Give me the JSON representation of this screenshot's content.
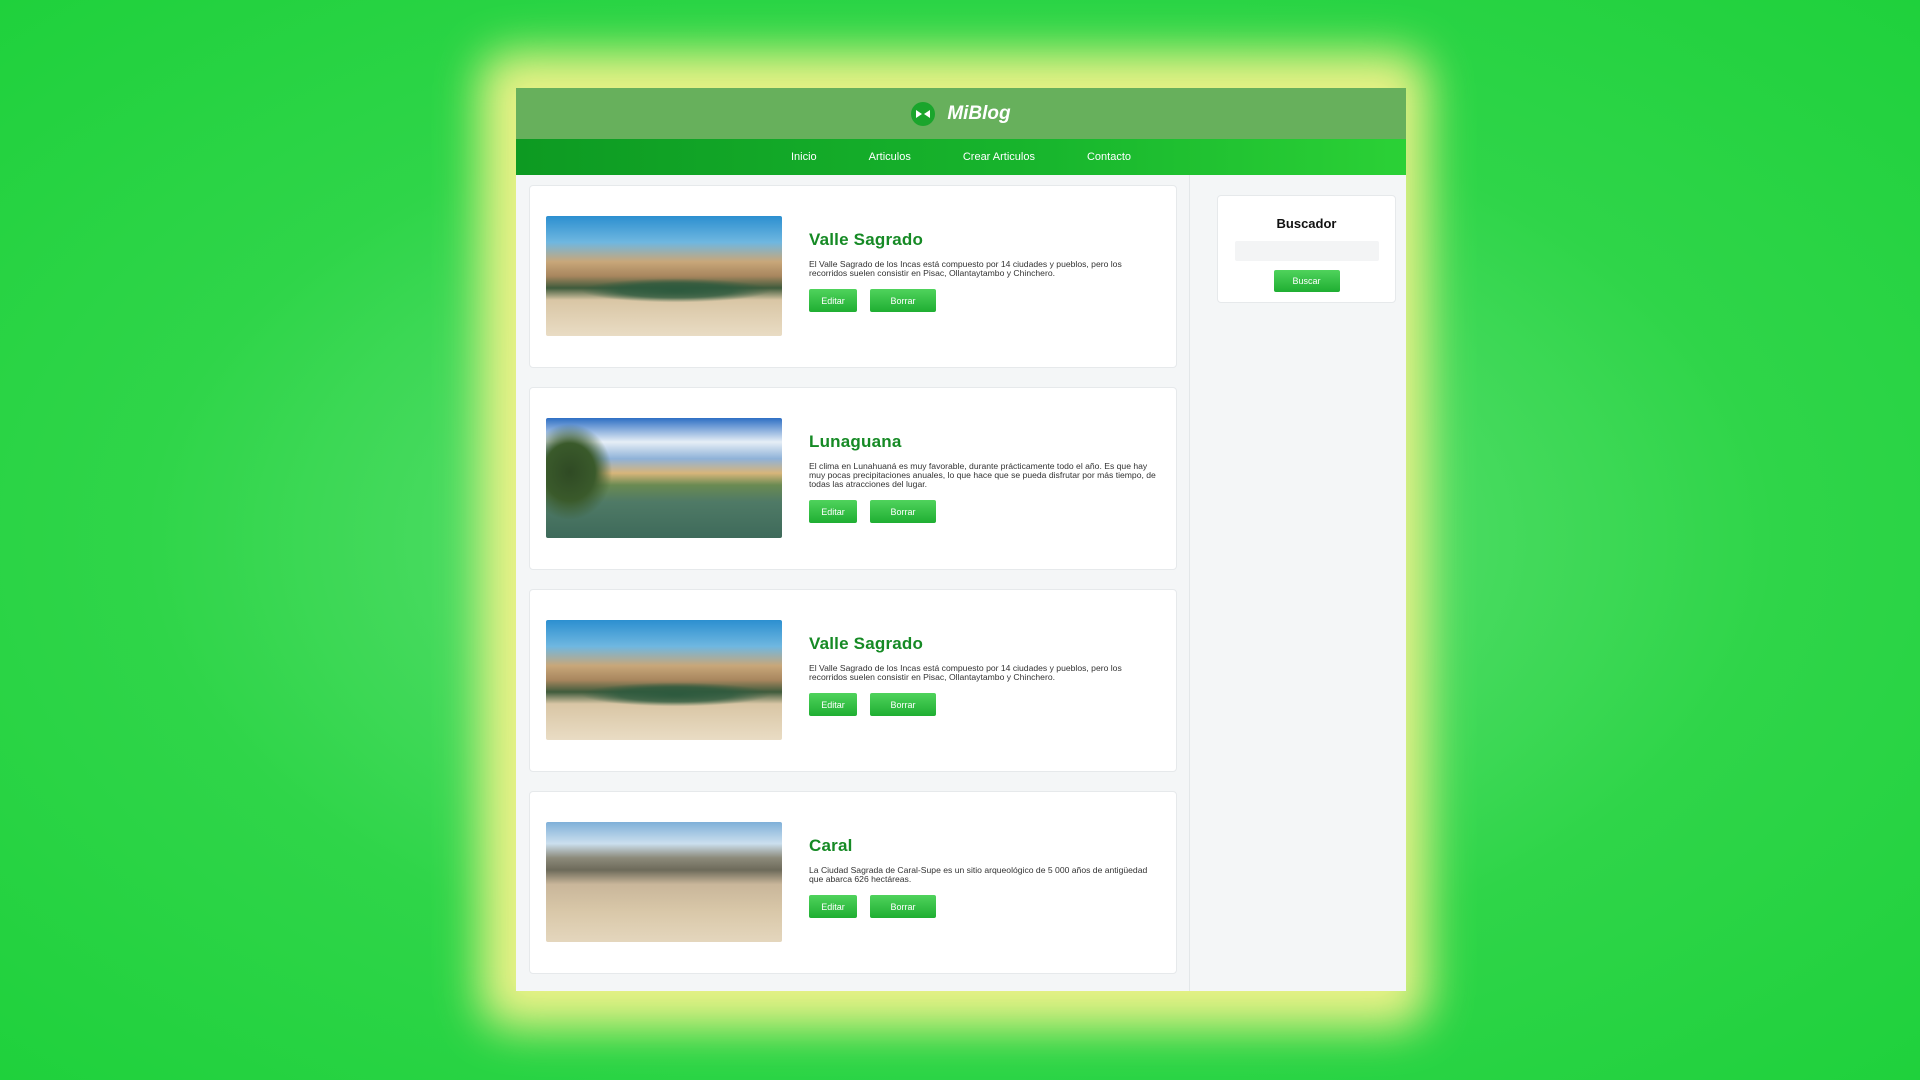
{
  "header": {
    "brand": "MiBlog",
    "logo_icon": "eye-logo-icon"
  },
  "nav": {
    "items": [
      "Inicio",
      "Articulos",
      "Crear Articulos",
      "Contacto"
    ]
  },
  "articles": [
    {
      "title": "Valle Sagrado",
      "description": "El Valle Sagrado de los Incas está compuesto por 14 ciudades y pueblos, pero los recorridos suelen consistir en Pisac, Ollantaytambo y Chinchero.",
      "edit_label": "Editar",
      "delete_label": "Borrar"
    },
    {
      "title": "Lunaguana",
      "description": "El clima en Lunahuaná es muy favorable, durante prácticamente todo el año. Es que hay muy pocas precipitaciones anuales, lo que hace que se pueda disfrutar por más tiempo, de todas las atracciones del lugar.",
      "edit_label": "Editar",
      "delete_label": "Borrar"
    },
    {
      "title": "Valle Sagrado",
      "description": "El Valle Sagrado de los Incas está compuesto por 14 ciudades y pueblos, pero los recorridos suelen consistir en Pisac, Ollantaytambo y Chinchero.",
      "edit_label": "Editar",
      "delete_label": "Borrar"
    },
    {
      "title": "Caral",
      "description": "La Ciudad Sagrada de Caral-Supe es un sitio arqueológico de 5 000 años de antigüedad que abarca 626 hectáreas.",
      "edit_label": "Editar",
      "delete_label": "Borrar"
    }
  ],
  "sidebar": {
    "search_title": "Buscador",
    "search_placeholder": "",
    "search_button": "Buscar"
  },
  "colors": {
    "header_bg": "#67b05c",
    "nav_bg": "#18b62d",
    "accent_title": "#168a25",
    "button": "#1fae32",
    "background": "#2fd549"
  }
}
